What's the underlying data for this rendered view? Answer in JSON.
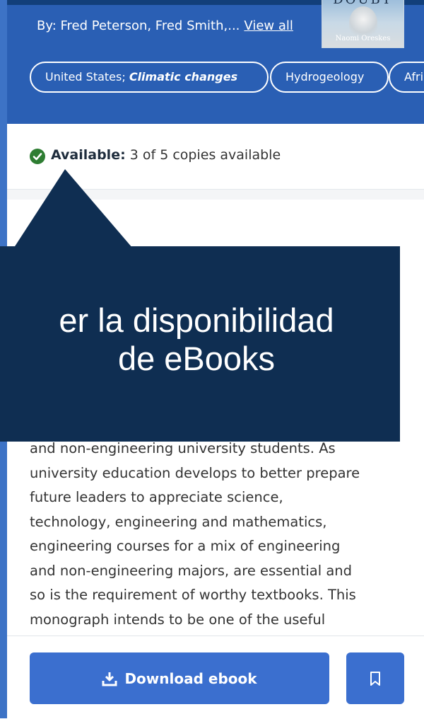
{
  "header": {
    "authors_prefix": "By: Fred Peterson, Fred Smith,...",
    "view_all": "View all",
    "cover": {
      "title": "DOUBT",
      "author": "Naomi Oreskes"
    },
    "tags": [
      {
        "plain": "United States; ",
        "emph": "Climatic changes"
      },
      {
        "plain": "Hydrogeology",
        "emph": ""
      },
      {
        "plain": "Afri",
        "emph": ""
      }
    ]
  },
  "availability": {
    "label": "Available:",
    "detail": "3 of 5 copies available",
    "icon": "check-circle-icon",
    "color": "#2e7d32"
  },
  "callout": {
    "lines": [
      "er la disponibilidad",
      "de eBooks"
    ],
    "background": "#0f2e52"
  },
  "description": {
    "lines": [
      "and non-engineering university students. As",
      "university education develops to better prepare",
      "future leaders to appreciate science,",
      "technology, engineering and mathematics,",
      "engineering courses for a mix of engineering",
      "and non-engineering majors, are essential and",
      "so is the requirement of worthy textbooks. This",
      "monograph intends to be one of the useful"
    ]
  },
  "actions": {
    "download_label": "Download ebook",
    "download_icon": "download-icon",
    "bookmark_icon": "bookmark-icon",
    "accent": "#3b6fcf"
  }
}
